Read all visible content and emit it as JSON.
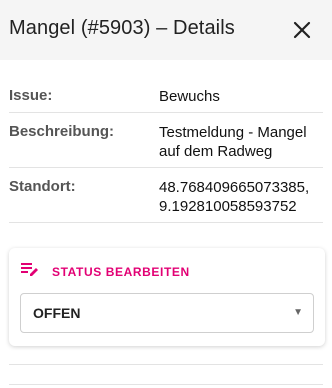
{
  "dialog": {
    "title": "Mangel (#5903) – Details",
    "close_icon": "close-icon"
  },
  "details": [
    {
      "label": "Issue:",
      "value": "Bewuchs"
    },
    {
      "label": "Beschreibung:",
      "value": "Testmeldung - Mangel auf dem Radweg"
    },
    {
      "label": "Standort:",
      "value": "48.768409665073385, 9.192810058593752"
    }
  ],
  "status_card": {
    "icon": "edit-note-icon",
    "title": "STATUS BEARBEITEN",
    "selected": "OFFEN",
    "accent_color": "#e20074"
  }
}
